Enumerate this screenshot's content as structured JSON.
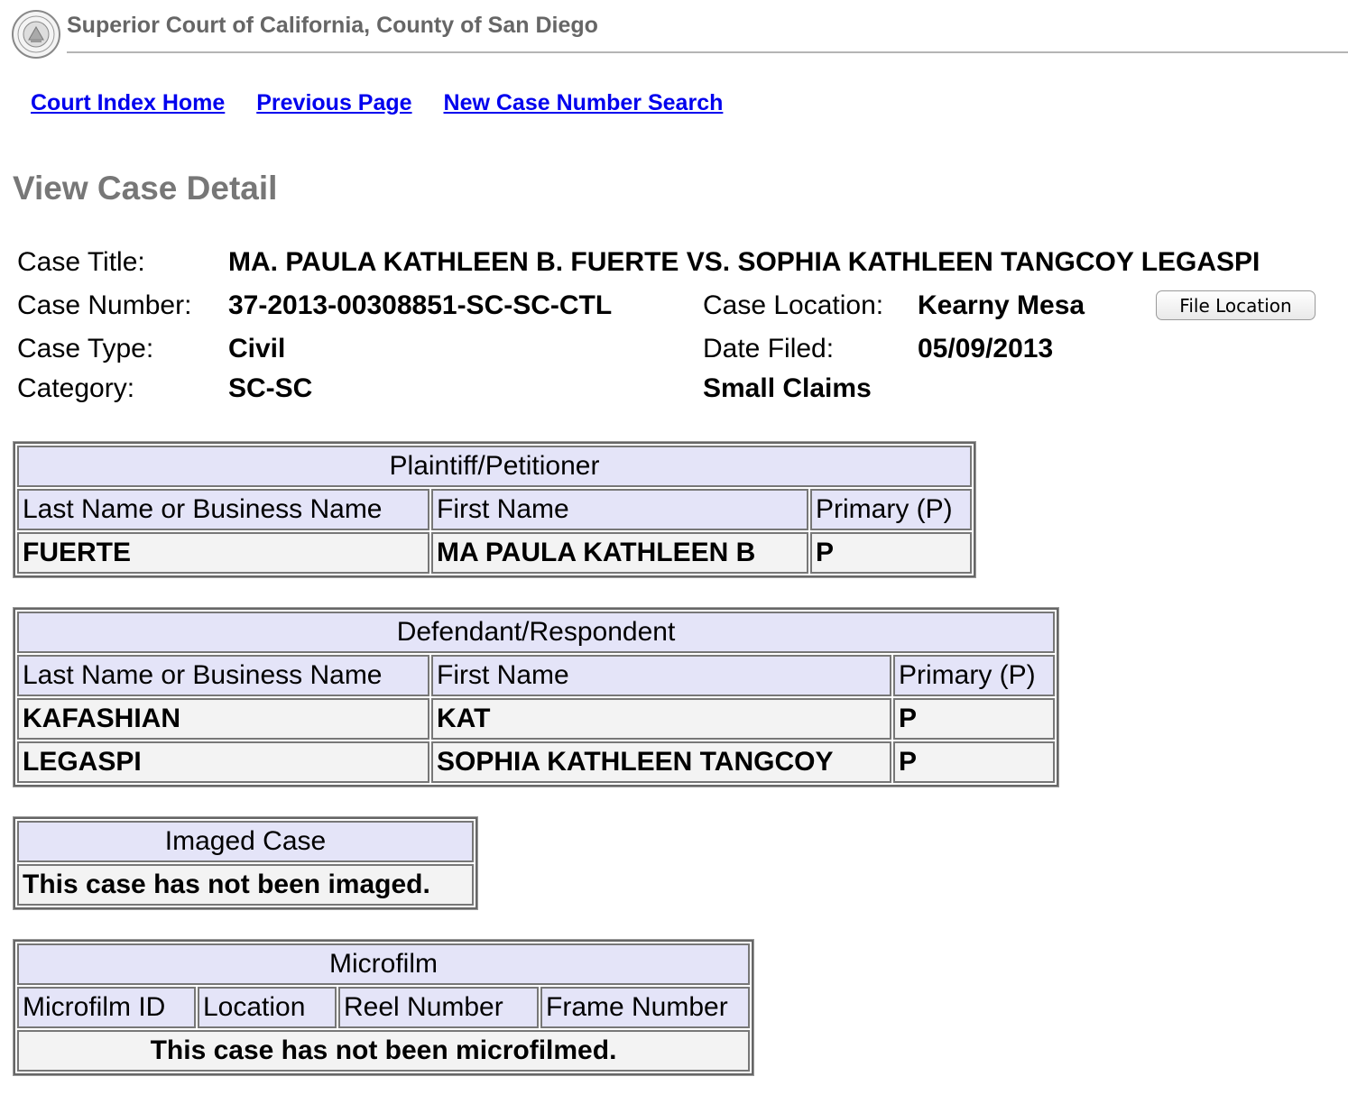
{
  "header": {
    "court_name": "Superior Court of California, County of San Diego",
    "seal_icon": "court-seal-icon"
  },
  "nav": {
    "links": [
      "Court Index Home",
      "Previous Page",
      "New Case Number Search"
    ]
  },
  "page": {
    "heading": "View Case Detail"
  },
  "case": {
    "title_label": "Case Title:",
    "title_value": "MA. PAULA KATHLEEN B. FUERTE VS. SOPHIA KATHLEEN TANGCOY LEGASPI",
    "number_label": "Case Number:",
    "number_value": "37-2013-00308851-SC-SC-CTL",
    "location_label": "Case Location:",
    "location_value": "Kearny Mesa",
    "file_location_button": "File Location",
    "type_label": "Case Type:",
    "type_value": "Civil",
    "filed_label": "Date Filed:",
    "filed_value": "05/09/2013",
    "category_label": "Category:",
    "category_value": "SC-SC",
    "category_desc": "Small Claims"
  },
  "plaintiff": {
    "title": "Plaintiff/Petitioner",
    "columns": [
      "Last Name or Business Name",
      "First Name",
      "Primary (P)"
    ],
    "rows": [
      [
        "FUERTE",
        "MA PAULA KATHLEEN B",
        "P"
      ]
    ]
  },
  "defendant": {
    "title": "Defendant/Respondent",
    "columns": [
      "Last Name or Business Name",
      "First Name",
      "Primary (P)"
    ],
    "rows": [
      [
        "KAFASHIAN",
        "KAT",
        "P"
      ],
      [
        "LEGASPI",
        "SOPHIA KATHLEEN TANGCOY",
        "P"
      ]
    ]
  },
  "imaged": {
    "title": "Imaged Case",
    "message": "This case has not been imaged."
  },
  "microfilm": {
    "title": "Microfilm",
    "columns": [
      "Microfilm ID",
      "Location",
      "Reel Number",
      "Frame Number"
    ],
    "message": "This case has not been microfilmed."
  }
}
